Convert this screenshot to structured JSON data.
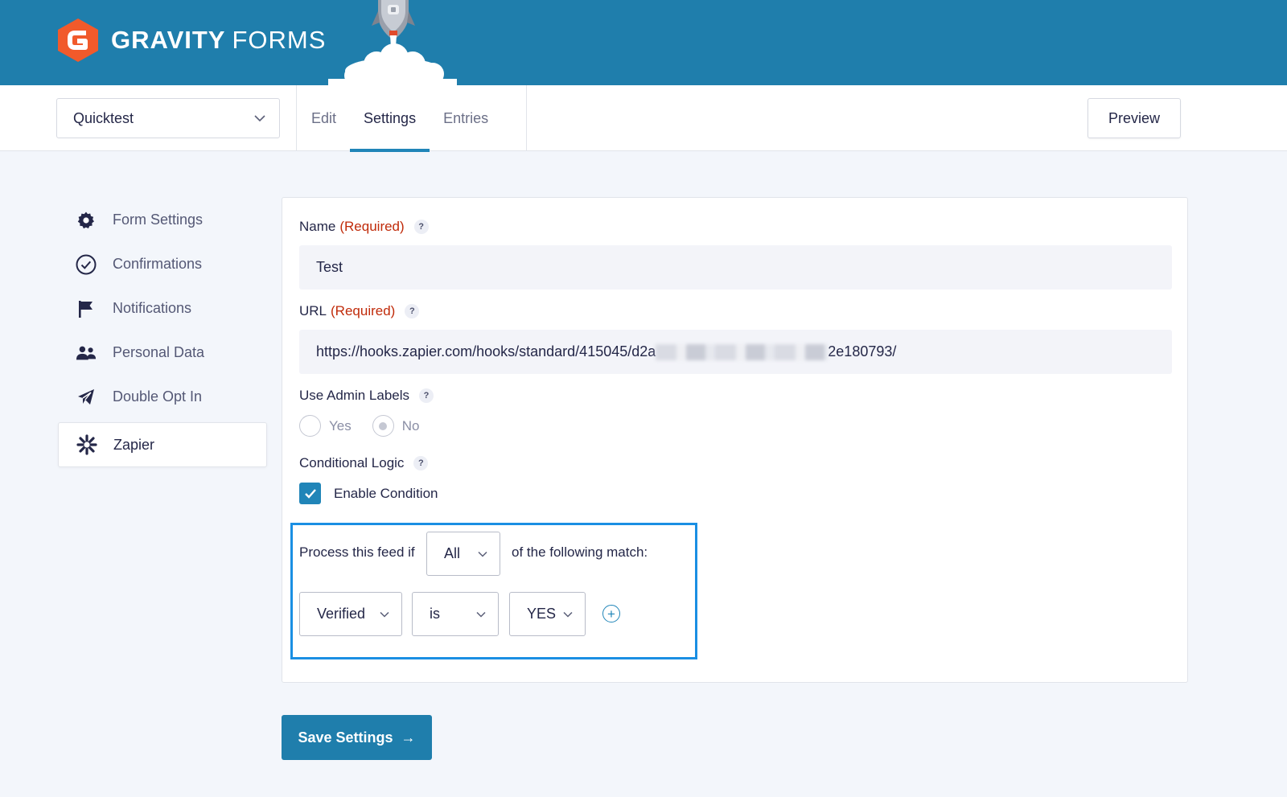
{
  "brand": {
    "name_bold": "GRAVITY",
    "name_light": "FORMS",
    "accent": "#1f7eac",
    "logo_color": "#f15a2b"
  },
  "toolbar": {
    "form_selector": "Quicktest",
    "tabs": [
      {
        "label": "Edit",
        "active": false
      },
      {
        "label": "Settings",
        "active": true
      },
      {
        "label": "Entries",
        "active": false
      }
    ],
    "preview_label": "Preview"
  },
  "sidebar": {
    "items": [
      {
        "label": "Form Settings",
        "icon": "gear-icon"
      },
      {
        "label": "Confirmations",
        "icon": "check-circle-icon"
      },
      {
        "label": "Notifications",
        "icon": "flag-icon"
      },
      {
        "label": "Personal Data",
        "icon": "users-icon"
      },
      {
        "label": "Double Opt In",
        "icon": "send-icon"
      },
      {
        "label": "Zapier",
        "icon": "zapier-icon",
        "active": true
      }
    ]
  },
  "form": {
    "name": {
      "label": "Name",
      "required": "(Required)",
      "help": "?",
      "value": "Test"
    },
    "url": {
      "label": "URL",
      "required": "(Required)",
      "help": "?",
      "value_start": "https://hooks.zapier.com/hooks/standard/415045/d2a",
      "value_end": "2e180793/"
    },
    "admin_labels": {
      "label": "Use Admin Labels",
      "help": "?",
      "yes": "Yes",
      "no": "No",
      "selected": "No"
    },
    "conditional_logic": {
      "label": "Conditional Logic",
      "help": "?",
      "checkbox_label": "Enable Condition",
      "checked": true,
      "prefix": "Process this feed if",
      "match": "All",
      "suffix": "of the following match:",
      "rule": {
        "field": "Verified",
        "operator": "is",
        "value": "YES"
      },
      "add_symbol": "+"
    }
  },
  "save": {
    "label": "Save Settings",
    "arrow": "→"
  }
}
